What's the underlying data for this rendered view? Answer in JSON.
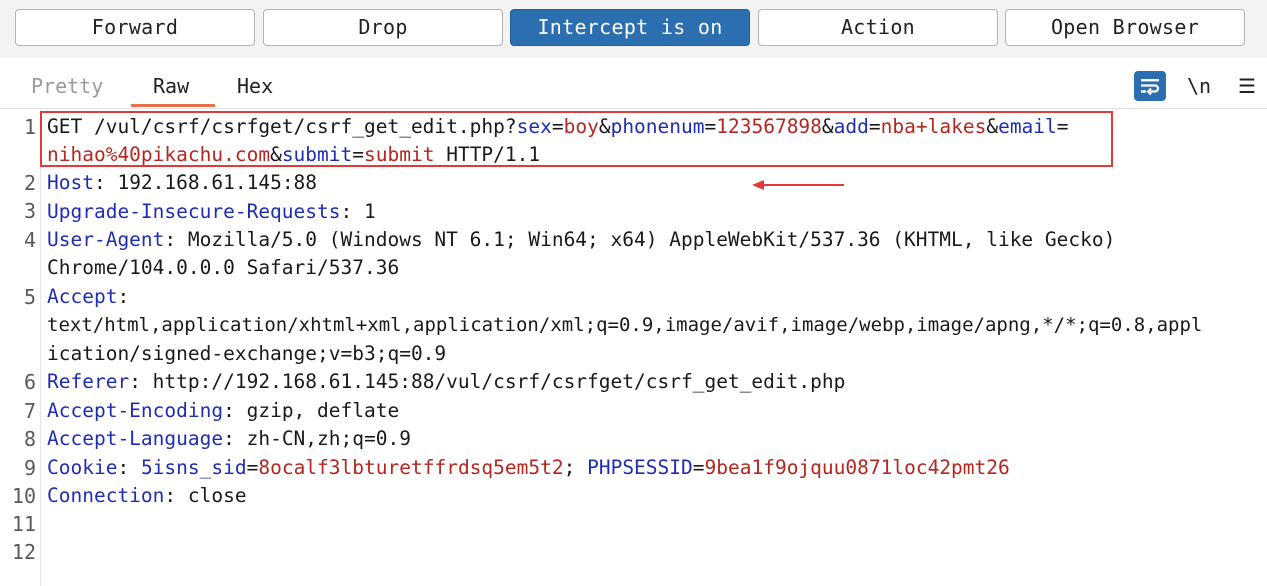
{
  "toolbar": {
    "forward": "Forward",
    "drop": "Drop",
    "intercept": "Intercept is on",
    "action": "Action",
    "open_browser": "Open Browser"
  },
  "tabs": {
    "pretty": "Pretty",
    "raw": "Raw",
    "hex": "Hex"
  },
  "icons": {
    "newline_label": "\\n",
    "menu_glyph": "☰"
  },
  "colors": {
    "accent": "#2c6fb0",
    "tab_underline": "#e8704a",
    "header_key": "#1f2db4",
    "param_value": "#b4261f",
    "highlight": "#e03a3a"
  },
  "request": {
    "line_numbers": [
      "1",
      "2",
      "3",
      "4",
      "5",
      "6",
      "7",
      "8",
      "9",
      "10",
      "11",
      "12"
    ],
    "l1": {
      "method_path": "GET /vul/csrf/csrfget/csrf_get_edit.php?",
      "p1_key": "sex",
      "eq1": "=",
      "p1_val": "boy",
      "amp1": "&",
      "p2_key": "phonenum",
      "eq2": "=",
      "p2_val": "123567898",
      "amp2": "&",
      "p3_key": "add",
      "eq3": "=",
      "p3_val": "nba+lakes",
      "amp3": "&",
      "p4_key": "email",
      "eq4": "=",
      "p4_val": "nihao%40pikachu.com",
      "amp4": "&",
      "p5_key": "submit",
      "eq5": "=",
      "p5_val": "submit",
      "proto": " HTTP/1.1"
    },
    "host": {
      "key": "Host",
      "sep": ": ",
      "value": "192.168.61.145:88"
    },
    "upgrade": {
      "key": "Upgrade-Insecure-Requests",
      "sep": ": ",
      "value": "1"
    },
    "ua": {
      "key": "User-Agent",
      "sep": ": ",
      "value1": "Mozilla/5.0 (Windows NT 6.1; Win64; x64) AppleWebKit/537.36 (KHTML, like Gecko)",
      "value2": "Chrome/104.0.0.0 Safari/537.36"
    },
    "accept": {
      "key": "Accept",
      "sep": ":",
      "value1": "text/html,application/xhtml+xml,application/xml;q=0.9,image/avif,image/webp,image/apng,*/*;q=0.8,appl",
      "value2": "ication/signed-exchange;v=b3;q=0.9"
    },
    "referer": {
      "key": "Referer",
      "sep": ": ",
      "value": "http://192.168.61.145:88/vul/csrf/csrfget/csrf_get_edit.php"
    },
    "encoding": {
      "key": "Accept-Encoding",
      "sep": ": ",
      "value": "gzip, deflate"
    },
    "language": {
      "key": "Accept-Language",
      "sep": ": ",
      "value": "zh-CN,zh;q=0.9"
    },
    "cookie": {
      "key": "Cookie",
      "sep": ": ",
      "c1_key": "5isns_sid",
      "c1_eq": "=",
      "c1_val": "8ocalf3lbturetffrdsq5em5t2",
      "c_sep": "; ",
      "c2_key": "PHPSESSID",
      "c2_eq": "=",
      "c2_val": "9bea1f9ojquu0871loc42pmt26"
    },
    "connection": {
      "key": "Connection",
      "sep": ": ",
      "value": "close"
    }
  }
}
